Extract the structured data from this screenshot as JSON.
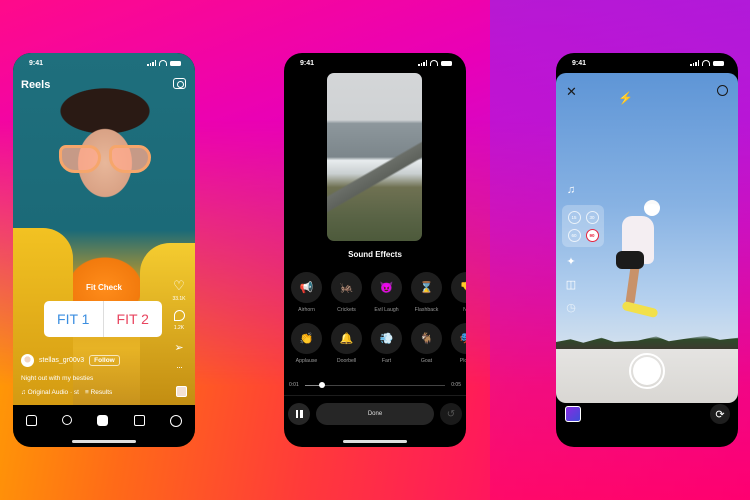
{
  "colors": {
    "background_top_left": "#ff0a8a",
    "background_top_right": "#8b2cf0",
    "background_bottom_left": "#ffa600",
    "background_bottom_right": "#ff0070",
    "poll_option_1": "#3b8ee0",
    "poll_option_2": "#e8445f",
    "timer_selected": "#e8233e"
  },
  "phones": [
    {
      "status": {
        "time": "9:41"
      },
      "header": {
        "title": "Reels",
        "camera_icon": "camera-icon"
      },
      "poll": {
        "label": "Fit Check",
        "option_1": "FIT 1",
        "option_2": "FIT 2"
      },
      "actions": {
        "likes": "33.1K",
        "comments": "1.2K",
        "like_icon": "♡",
        "send_icon": "➢",
        "more_icon": "···"
      },
      "post": {
        "username": "stellas_gr00v3",
        "follow_label": "Follow",
        "caption": "Night out with my besties",
        "audio": "♫ Original Audio · st",
        "results": "Results"
      },
      "nav": [
        "home-icon",
        "search-icon",
        "reels-icon",
        "shop-icon",
        "profile-icon"
      ]
    },
    {
      "status": {
        "time": "9:41"
      },
      "title": "Sound Effects",
      "effects": [
        {
          "label": "Airhorn",
          "icon": "📢"
        },
        {
          "label": "Crickets",
          "icon": "🦗"
        },
        {
          "label": "Evil Laugh",
          "icon": "😈"
        },
        {
          "label": "Flashback",
          "icon": "⌛"
        },
        {
          "label": "No",
          "icon": "👎"
        },
        {
          "label": "Applause",
          "icon": "👏"
        },
        {
          "label": "Doorbell",
          "icon": "🔔"
        },
        {
          "label": "Fart",
          "icon": "💨"
        },
        {
          "label": "Goat",
          "icon": "🐐"
        },
        {
          "label": "Plot T",
          "icon": "🎭"
        }
      ],
      "playback": {
        "current": "0:01",
        "end": "0:05",
        "progress": 0.12
      },
      "done_label": "Done"
    },
    {
      "status": {
        "time": "9:41"
      },
      "timer_options": [
        "15",
        "30",
        "60",
        "90"
      ],
      "timer_selected": "90",
      "icons": {
        "close": "✕",
        "flash_off": "⚡",
        "music": "♫",
        "effects": "✦",
        "layout": "◫",
        "timer": "◷",
        "flip": "⟳"
      }
    }
  ]
}
